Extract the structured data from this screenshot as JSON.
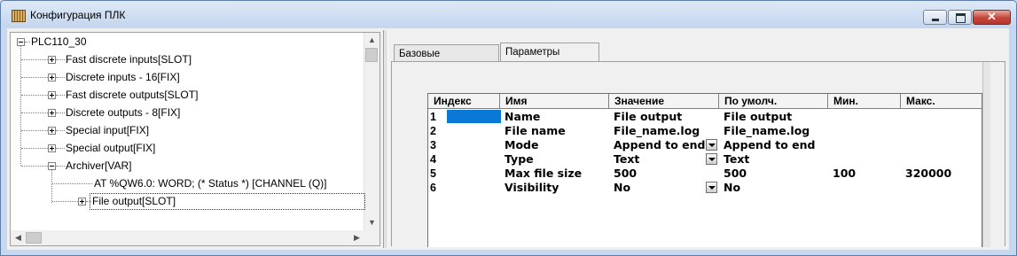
{
  "window": {
    "title": "Конфигурация ПЛК"
  },
  "tree": {
    "root": "PLC110_30",
    "items": [
      {
        "label": "Fast discrete inputs[SLOT]",
        "expander": "plus"
      },
      {
        "label": "Discrete inputs - 16[FIX]",
        "expander": "plus"
      },
      {
        "label": "Fast discrete outputs[SLOT]",
        "expander": "plus"
      },
      {
        "label": "Discrete outputs - 8[FIX]",
        "expander": "plus"
      },
      {
        "label": "Special input[FIX]",
        "expander": "plus"
      },
      {
        "label": "Special output[FIX]",
        "expander": "plus"
      },
      {
        "label": "Archiver[VAR]",
        "expander": "minus"
      }
    ],
    "archiver_children": [
      {
        "label": "AT %QW6.0: WORD; (* Status *) [CHANNEL (Q)]"
      },
      {
        "label": "File output[SLOT]",
        "expander": "plus",
        "selected": true
      }
    ]
  },
  "tabs": [
    {
      "label": "Базовые параметры",
      "active": false
    },
    {
      "label": "Параметры модуля",
      "active": true
    }
  ],
  "grid": {
    "headers": [
      "Индекс",
      "Имя",
      "Значение",
      "По умолч.",
      "Мин.",
      "Макс."
    ],
    "rows": [
      {
        "index": "1",
        "name": "Name",
        "value": "File output",
        "has_dropdown": false,
        "default": "File output",
        "min": "",
        "max": ""
      },
      {
        "index": "2",
        "name": "File name",
        "value": "File_name.log",
        "has_dropdown": false,
        "default": "File_name.log",
        "min": "",
        "max": ""
      },
      {
        "index": "3",
        "name": "Mode",
        "value": "Append to end",
        "has_dropdown": true,
        "default": "Append to end",
        "min": "",
        "max": ""
      },
      {
        "index": "4",
        "name": "Type",
        "value": "Text",
        "has_dropdown": true,
        "default": "Text",
        "min": "",
        "max": ""
      },
      {
        "index": "5",
        "name": "Max file size",
        "value": "500",
        "has_dropdown": false,
        "default": "500",
        "min": "100",
        "max": "320000"
      },
      {
        "index": "6",
        "name": "Visibility",
        "value": "No",
        "has_dropdown": true,
        "default": "No",
        "min": "",
        "max": ""
      }
    ],
    "selected_row_index": "1"
  },
  "colors": {
    "selection": "#0a78d7",
    "title_bar": "#c4d6ee",
    "close_button": "#c4443a"
  }
}
